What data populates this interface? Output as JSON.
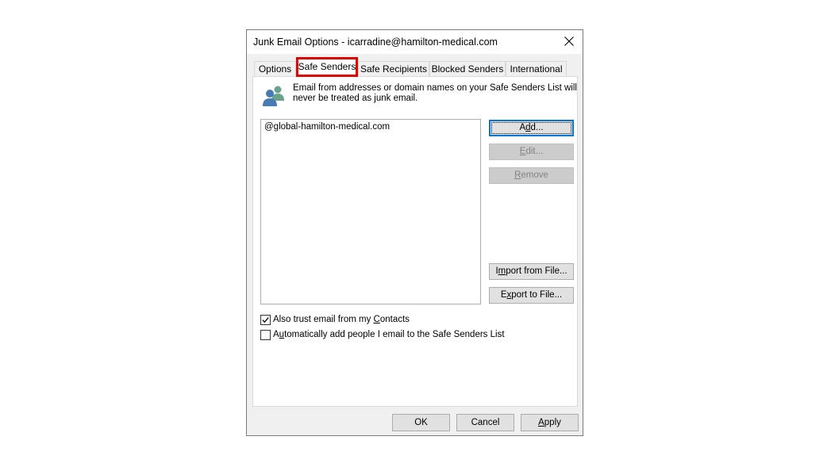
{
  "dialog": {
    "title": "Junk Email Options - icarradine@hamilton-medical.com",
    "close_icon": "close-icon"
  },
  "tabs": [
    {
      "label": "Options",
      "active": false
    },
    {
      "label": "Safe Senders",
      "active": true
    },
    {
      "label": "Safe Recipients",
      "active": false
    },
    {
      "label": "Blocked Senders",
      "active": false
    },
    {
      "label": "International",
      "active": false
    }
  ],
  "panel": {
    "icon": "people-icon",
    "description_line1": "Email from addresses or domain names on your Safe Senders List will",
    "description_line2": "never be treated as junk email.",
    "list_items": [
      "@global-hamilton-medical.com"
    ],
    "buttons": {
      "add": {
        "pre": "A",
        "key": "d",
        "post": "d..."
      },
      "edit": {
        "pre": "",
        "key": "E",
        "post": "dit..."
      },
      "remove": {
        "pre": "",
        "key": "R",
        "post": "emove"
      },
      "import": {
        "pre": "I",
        "key": "m",
        "post": "port from File..."
      },
      "export": {
        "pre": "E",
        "key": "x",
        "post": "port to File..."
      }
    },
    "checkboxes": [
      {
        "pre": "Also trust email from my ",
        "key": "C",
        "post": "ontacts",
        "checked": true
      },
      {
        "pre": "A",
        "key": "u",
        "post": "tomatically add people I email to the Safe Senders List",
        "checked": false
      }
    ]
  },
  "footer": {
    "ok": "OK",
    "cancel": "Cancel",
    "apply_key": "A",
    "apply_post": "pply"
  },
  "colors": {
    "highlight_border": "#e00000",
    "default_button_border": "#0078d7",
    "people_icon_blue": "#4a7ab5",
    "people_icon_teal": "#69a38b"
  }
}
